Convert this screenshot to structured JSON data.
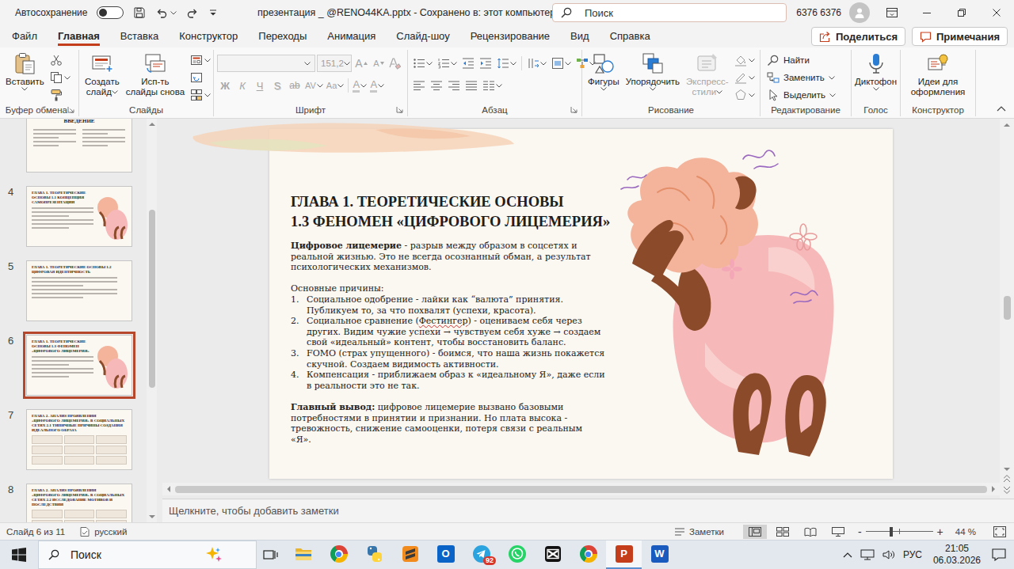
{
  "window": {
    "autosave_label": "Автосохранение",
    "autosave_on": false,
    "title": "презентация _ @RENO44KA.pptx - Сохранено в: этот компьютер",
    "search_placeholder": "Поиск",
    "user": "6376 6376"
  },
  "menu_tabs": [
    {
      "label": "Файл",
      "selected": false
    },
    {
      "label": "Главная",
      "selected": true
    },
    {
      "label": "Вставка",
      "selected": false
    },
    {
      "label": "Конструктор",
      "selected": false
    },
    {
      "label": "Переходы",
      "selected": false
    },
    {
      "label": "Анимация",
      "selected": false
    },
    {
      "label": "Слайд-шоу",
      "selected": false
    },
    {
      "label": "Рецензирование",
      "selected": false
    },
    {
      "label": "Вид",
      "selected": false
    },
    {
      "label": "Справка",
      "selected": false
    }
  ],
  "share_button": "Поделиться",
  "comments_button": "Примечания",
  "ribbon": {
    "clipboard": {
      "label": "Буфер обмена",
      "paste": "Вставить"
    },
    "slides": {
      "label": "Слайды",
      "new_slide": [
        "Создать",
        "слайд"
      ],
      "reuse": [
        "Исп-ть",
        "слайды снова"
      ]
    },
    "font": {
      "label": "Шрифт",
      "disabled": true,
      "font_size": "151,2",
      "size_buttons": [
        "A",
        "A"
      ],
      "style_buttons": [
        "Ж",
        "К",
        "Ч",
        "S",
        "ab"
      ],
      "spacing_buttons": [
        "AV",
        "Aa"
      ],
      "color_buttons": [
        "A",
        "A"
      ]
    },
    "paragraph": {
      "label": "Абзац"
    },
    "drawing": {
      "label": "Рисование",
      "buttons": [
        {
          "label": [
            "Фигуры"
          ],
          "kind": "shapes",
          "disabled": false
        },
        {
          "label": [
            "Упорядочить"
          ],
          "kind": "arrange",
          "disabled": false
        },
        {
          "label": [
            "Экспресс-",
            "стили"
          ],
          "kind": "styles",
          "disabled": true
        }
      ]
    },
    "editing": {
      "label": "Редактирование",
      "items": [
        {
          "label": "Найти",
          "kind": "find",
          "dropdown": false
        },
        {
          "label": "Заменить",
          "kind": "replace",
          "dropdown": true
        },
        {
          "label": "Выделить",
          "kind": "select",
          "dropdown": true
        }
      ]
    },
    "voice": {
      "label": "Голос",
      "button": "Диктофон"
    },
    "designer": {
      "label": "Конструктор",
      "button": [
        "Идеи для",
        "оформления"
      ]
    }
  },
  "thumbnails": [
    {
      "title": "ВВЕДЕНИЕ",
      "kind": "heading",
      "selected": false
    },
    {
      "number": "4",
      "title": "ГЛАВА 1. ТЕОРЕТИЧЕСКИЕ ОСНОВЫ 1.1 КОНЦЕПЦИЯ САМОПРЕЗЕНТАЦИИ",
      "kind": "picture",
      "selected": false
    },
    {
      "number": "5",
      "title": "ГЛАВА 1. ТЕОРЕТИЧЕСКИЕ ОСНОВЫ 1.2 ЦИФРОВАЯ ИДЕНТИЧНОСТЬ",
      "kind": "text",
      "selected": false
    },
    {
      "number": "6",
      "title": "ГЛАВА 1. ТЕОРЕТИЧЕСКИЕ ОСНОВЫ 1.3 ФЕНОМЕН «ЦИФРОВОГО ЛИЦЕМЕРИЯ»",
      "kind": "picture",
      "selected": true
    },
    {
      "number": "7",
      "title": "ГЛАВА 2. АНАЛИЗ ПРОЯВЛЕНИЙ «ЦИФРОВОГО ЛИЦЕМЕРИЯ» В СОЦИАЛЬНЫХ СЕТЯХ 2.1 ТИПИЧНЫЕ ПРИЧИНЫ СОЗДАНИЯ ИДЕАЛЬНОГО ОБРАЗА",
      "kind": "table",
      "selected": false
    },
    {
      "number": "8",
      "title": "ГЛАВА 2. АНАЛИЗ ПРОЯВЛЕНИЙ «ЦИФРОВОГО ЛИЦЕМЕРИЯ» В СОЦИАЛЬНЫХ СЕТЯХ 2.2 ИССЛЕДОВАНИЕ МОТИВОВ И ПОСЛЕДСТВИЙ",
      "kind": "table",
      "selected": false
    }
  ],
  "slide": {
    "title": [
      "ГЛАВА 1. ТЕОРЕТИЧЕСКИЕ ОСНОВЫ",
      "1.3 ФЕНОМЕН «ЦИФРОВОГО ЛИЦЕМЕРИЯ»"
    ],
    "definition": {
      "term": "Цифровое лицемерие",
      "text": " - разрыв между образом в соцсетях и реальной жизнью. Это не всегда осознанный обман, а результат психологических механизмов."
    },
    "causes_heading": "Основные причины:",
    "causes": [
      {
        "number": "1.",
        "segments": [
          {
            "text": "Социальное одобрение - лайки как “валюта” принятия. Публикуем то, за что похвалят (успехи, красота).",
            "spell_error": false
          }
        ]
      },
      {
        "number": "2.",
        "segments": [
          {
            "text": "Социальное сравнение (",
            "spell_error": false
          },
          {
            "text": "Фестингер",
            "spell_error": true
          },
          {
            "text": ") - оцениваем себя через других. Видим чужие успехи → чувствуем себя хуже → создаем свой «идеальный» контент, чтобы восстановить баланс.",
            "spell_error": false
          }
        ]
      },
      {
        "number": "3.",
        "segments": [
          {
            "text": "FOMO (страх упущенного) - боимся, что наша жизнь покажется скучной. Создаем видимость активности.",
            "spell_error": false
          }
        ]
      },
      {
        "number": "4.",
        "segments": [
          {
            "text": "Компенсация - приближаем образ к «идеальному Я», даже если в реальности это не так.",
            "spell_error": false
          }
        ]
      }
    ],
    "conclusion": {
      "term": "Главный вывод:",
      "text": " цифровое лицемерие вызвано базовыми потребностями в принятии и признании. Но плата высока - тревожность, снижение самооценки, потеря связи с реальным «Я»."
    }
  },
  "notes_placeholder": "Щелкните, чтобы добавить заметки",
  "status_bar": {
    "slide": "Слайд 6 из 11",
    "language": "русский",
    "notes": "Заметки",
    "views": [
      {
        "kind": "normal",
        "selected": true
      },
      {
        "kind": "sorter",
        "selected": false
      },
      {
        "kind": "reading",
        "selected": false
      },
      {
        "kind": "slideshow",
        "selected": false
      }
    ],
    "zoom_minus": "-",
    "zoom_plus": "+",
    "zoom_level": 0.38,
    "zoom": "44 %"
  },
  "taskbar": {
    "search": "Поиск",
    "apps": [
      {
        "kind": "explorer",
        "selected": false
      },
      {
        "kind": "chrome",
        "selected": false
      },
      {
        "kind": "python",
        "selected": false
      },
      {
        "kind": "sublime",
        "selected": false
      },
      {
        "kind": "outlook",
        "glyph": "O",
        "selected": false
      },
      {
        "kind": "telegram",
        "badge": "92",
        "selected": false
      },
      {
        "kind": "whatsapp",
        "selected": false
      },
      {
        "kind": "capcut",
        "selected": false
      },
      {
        "kind": "chrome",
        "selected": false
      },
      {
        "kind": "powerpoint",
        "glyph": "P",
        "selected": true
      },
      {
        "kind": "word",
        "glyph": "W",
        "selected": false
      }
    ],
    "language": "РУС",
    "time": "21:05",
    "date": "06.03.2026"
  }
}
